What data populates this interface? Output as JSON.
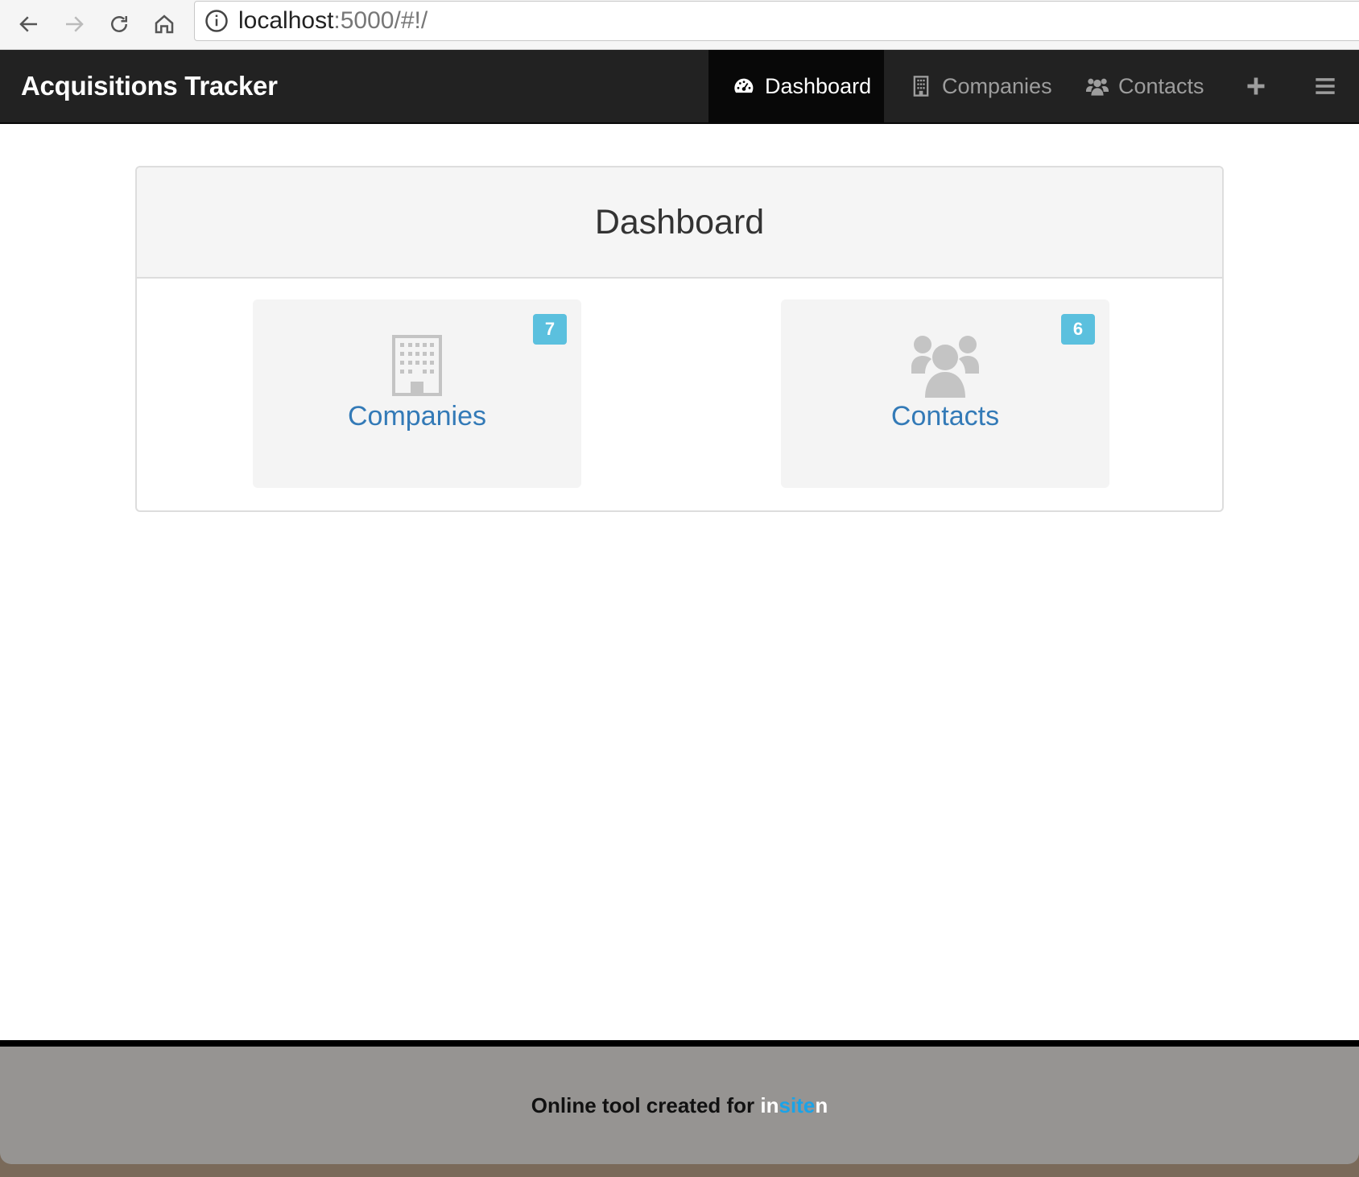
{
  "browser": {
    "url_host": "localhost",
    "url_path": ":5000/#!/"
  },
  "navbar": {
    "brand": "Acquisitions Tracker",
    "items": [
      {
        "label": "Dashboard",
        "icon": "dashboard-icon",
        "active": true
      },
      {
        "label": "Companies",
        "icon": "building-icon",
        "active": false
      },
      {
        "label": "Contacts",
        "icon": "users-icon",
        "active": false
      },
      {
        "label": "",
        "icon": "plus-icon",
        "active": false
      },
      {
        "label": "",
        "icon": "hamburger-icon",
        "active": false
      }
    ]
  },
  "dashboard": {
    "title": "Dashboard",
    "cards": [
      {
        "label": "Companies",
        "count": "7",
        "icon": "building-icon"
      },
      {
        "label": "Contacts",
        "count": "6",
        "icon": "users-icon"
      }
    ]
  },
  "footer": {
    "text": "Online tool created for ",
    "brand_part1": "in",
    "brand_part2": "site",
    "brand_part3": "n"
  },
  "colors": {
    "navbar_bg": "#222222",
    "badge_bg": "#5bc0de",
    "link": "#337ab7",
    "footer_brand_blue": "#1aa3e8"
  }
}
